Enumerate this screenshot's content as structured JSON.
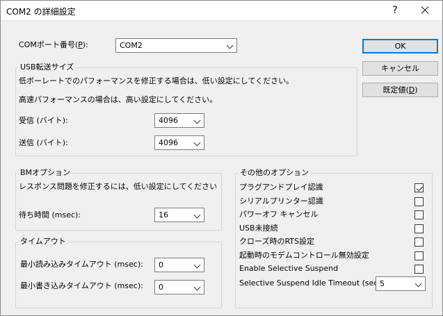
{
  "window": {
    "title": "COM2 の詳細設定",
    "help": "?"
  },
  "com_port": {
    "label_pre": "COMポート番号(",
    "label_key": "P",
    "label_post": "):",
    "value": "COM2"
  },
  "buttons": {
    "ok": "OK",
    "cancel": "キャンセル",
    "defaults_pre": "既定値(",
    "defaults_key": "D",
    "defaults_post": ")"
  },
  "usb_transfer": {
    "title": "USB転送サイズ",
    "desc_low": "低ボーレートでのパフォーマンスを修正する場合は、低い設定にしてください。",
    "desc_high": "高速パフォーマンスの場合は、高い設定にしてください。",
    "receive_label": "受信 (バイト):",
    "receive_value": "4096",
    "send_label": "送信 (バイト):",
    "send_value": "4096"
  },
  "bm_options": {
    "title": "BMオプション",
    "desc": "レスポンス問題を修正するには、低い設定にしてください",
    "latency_label": "待ち時間 (msec):",
    "latency_value": "16"
  },
  "timeouts": {
    "title": "タイムアウト",
    "read_label": "最小読み込みタイムアウト (msec):",
    "read_value": "0",
    "write_label": "最小書き込みタイムアウト (msec):",
    "write_value": "0"
  },
  "other_options": {
    "title": "その他のオプション",
    "items": [
      {
        "label": "プラグアンドプレイ認識",
        "checked": true
      },
      {
        "label": "シリアルプリンター認識",
        "checked": false
      },
      {
        "label": "パワーオフ キャンセル",
        "checked": false
      },
      {
        "label": "USB未接続",
        "checked": false
      },
      {
        "label": "クローズ時のRTS設定",
        "checked": false
      },
      {
        "label": "起動時のモデムコントロール無効設定",
        "checked": false
      },
      {
        "label": "Enable Selective Suspend",
        "checked": false
      }
    ],
    "idle_timeout_label": "Selective Suspend Idle Timeout (secs):",
    "idle_timeout_value": "5"
  },
  "colors": {
    "dialog_bg": "#f0f0f0",
    "accent": "#0078d7"
  }
}
